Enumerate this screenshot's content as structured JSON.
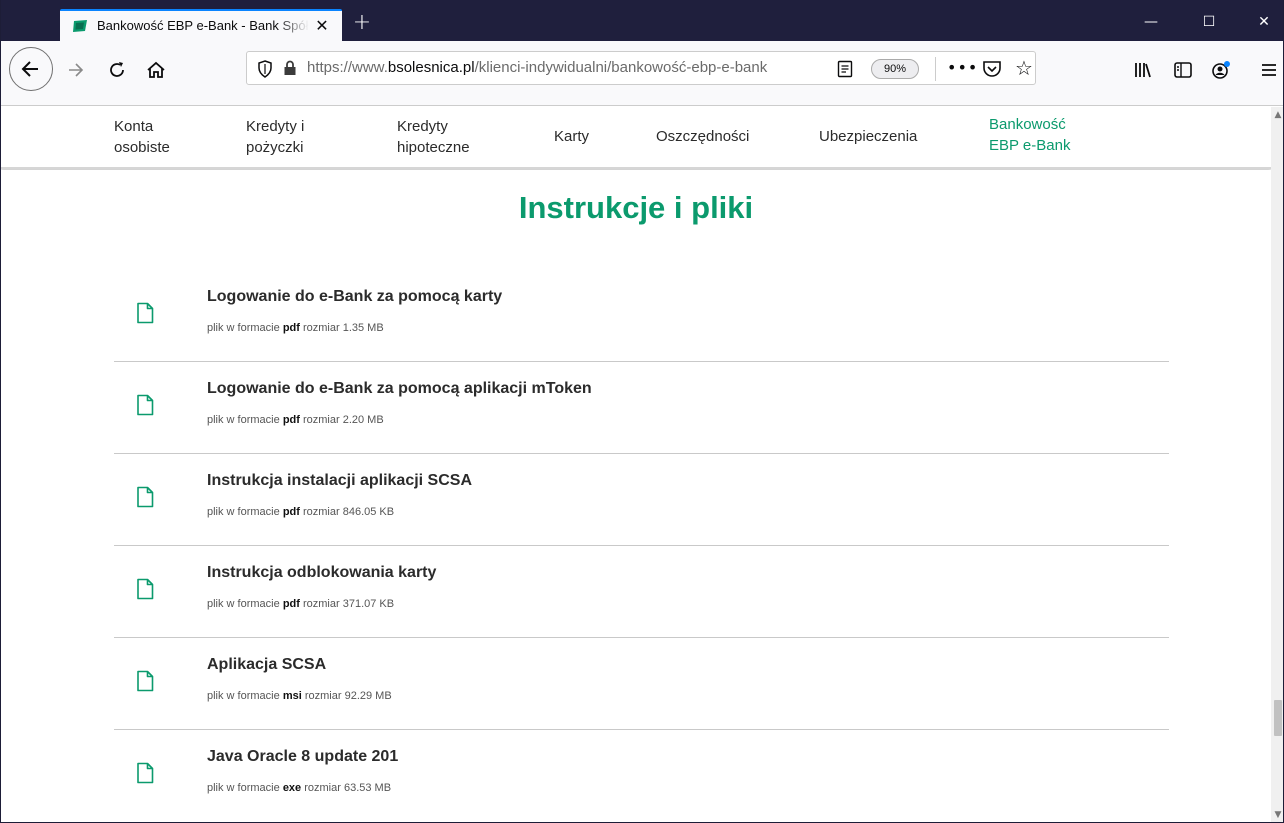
{
  "browser": {
    "tab_title": "Bankowość EBP e-Bank - Bank Spółdzielczy",
    "tab_close": "✕",
    "new_tab": "+",
    "window_controls": {
      "minimize": "—",
      "maximize": "☐",
      "close": "✕"
    },
    "url_prefix": "https://www.",
    "url_host": "bsolesnica.pl",
    "url_path": "/klienci-indywidualni/bankowość-ebp-e-bank",
    "zoom": "90%",
    "more": "•••",
    "icons": [
      "back-icon",
      "forward-icon",
      "reload-icon",
      "home-icon",
      "shield-icon",
      "lock-icon",
      "reader-view-icon",
      "pocket-icon",
      "bookmark-star-icon",
      "library-icon",
      "sidebar-icon",
      "account-icon",
      "menu-icon"
    ]
  },
  "site_nav": {
    "items": [
      {
        "line1": "Konta",
        "line2": "osobiste"
      },
      {
        "line1": "Kredyty i",
        "line2": "pożyczki"
      },
      {
        "line1": "Kredyty",
        "line2": "hipoteczne"
      },
      {
        "line1": "Karty",
        "line2": ""
      },
      {
        "line1": "Oszczędności",
        "line2": ""
      },
      {
        "line1": "Ubezpieczenia",
        "line2": ""
      },
      {
        "line1": "Bankowość",
        "line2": "EBP e-Bank"
      }
    ],
    "active_color": "#0b9a6d"
  },
  "main": {
    "title": "Instrukcje i pliki",
    "meta_prefix": "plik w formacie",
    "meta_size_label": "rozmiar",
    "files": [
      {
        "name": "Logowanie do e-Bank za pomocą karty",
        "format": "pdf",
        "size": "1.35 MB"
      },
      {
        "name": "Logowanie do e-Bank za pomocą aplikacji mToken",
        "format": "pdf",
        "size": "2.20 MB"
      },
      {
        "name": "Instrukcja instalacji aplikacji SCSA",
        "format": "pdf",
        "size": "846.05 KB"
      },
      {
        "name": "Instrukcja odblokowania karty",
        "format": "pdf",
        "size": "371.07 KB"
      },
      {
        "name": "Aplikacja SCSA",
        "format": "msi",
        "size": "92.29 MB"
      },
      {
        "name": "Java Oracle 8 update 201",
        "format": "exe",
        "size": "63.53 MB"
      }
    ],
    "accent_color": "#0b9a6d"
  }
}
